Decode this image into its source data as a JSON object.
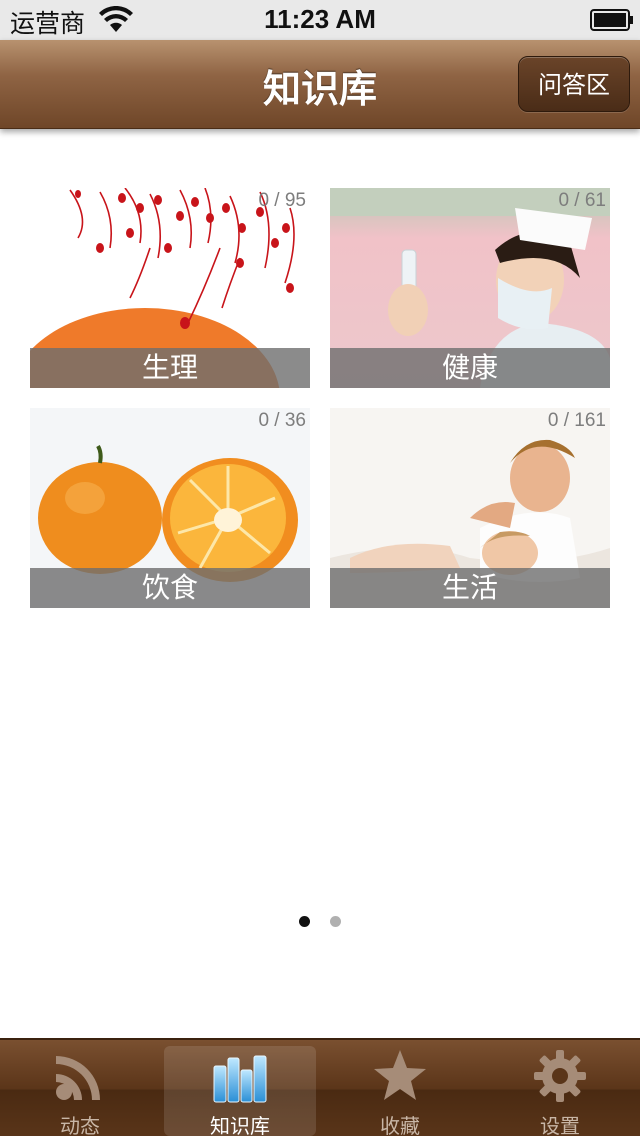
{
  "status_bar": {
    "carrier": "运营商",
    "time": "11:23 AM"
  },
  "nav": {
    "title": "知识库",
    "right_button": "问答区"
  },
  "tiles": [
    {
      "label": "生理",
      "count": "0 / 95",
      "icon": "sperm-orange-illustration"
    },
    {
      "label": "健康",
      "count": "0 / 61",
      "icon": "nurse-photo"
    },
    {
      "label": "饮食",
      "count": "0 / 36",
      "icon": "orange-fruit-photo"
    },
    {
      "label": "生活",
      "count": "0 / 161",
      "icon": "couple-photo"
    }
  ],
  "pagination": {
    "current": 1,
    "total": 2
  },
  "tabs": [
    {
      "label": "动态",
      "icon": "rss-icon",
      "selected": false
    },
    {
      "label": "知识库",
      "icon": "bookshelf-icon",
      "selected": true
    },
    {
      "label": "收藏",
      "icon": "star-icon",
      "selected": false
    },
    {
      "label": "设置",
      "icon": "gear-icon",
      "selected": false
    }
  ],
  "colors": {
    "nav_brown": "#8f6444",
    "tab_active": "#ffffff",
    "tab_inactive": "#c8b6a6",
    "dot_active": "#111111",
    "dot_inactive": "#b0b0b0"
  }
}
